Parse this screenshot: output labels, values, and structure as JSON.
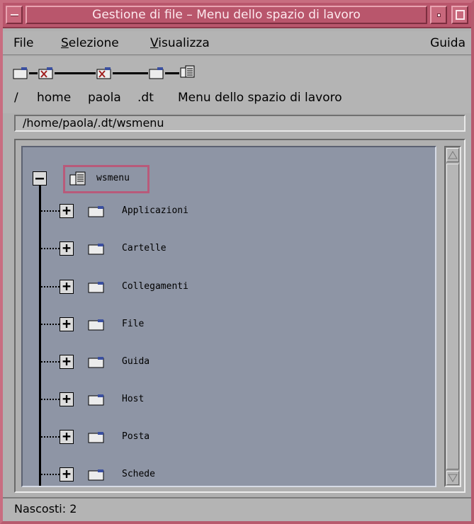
{
  "window": {
    "title": "Gestione di file – Menu dello spazio di lavoro"
  },
  "menubar": {
    "file": "File",
    "selezione": "Selezione",
    "visualizza": "Visualizza",
    "guida": "Guida"
  },
  "iconic_path": {
    "labels": [
      "/",
      "home",
      "paola",
      ".dt",
      "Menu dello spazio di lavoro"
    ]
  },
  "current_path": "/home/paola/.dt/wsmenu",
  "tree": {
    "root": {
      "label": "wsmenu",
      "toggle": "–",
      "icon": "wsmenu-file-icon"
    },
    "children": [
      {
        "label": "Applicazioni",
        "toggle": "+",
        "icon": "folder-icon"
      },
      {
        "label": "Cartelle",
        "toggle": "+",
        "icon": "folder-icon"
      },
      {
        "label": "Collegamenti",
        "toggle": "+",
        "icon": "folder-icon"
      },
      {
        "label": "File",
        "toggle": "+",
        "icon": "folder-icon"
      },
      {
        "label": "Guida",
        "toggle": "+",
        "icon": "folder-icon"
      },
      {
        "label": "Host",
        "toggle": "+",
        "icon": "folder-icon"
      },
      {
        "label": "Posta",
        "toggle": "+",
        "icon": "folder-icon"
      },
      {
        "label": "Schede",
        "toggle": "+",
        "icon": "folder-icon"
      }
    ]
  },
  "status": "Nascosti: 2",
  "colors": {
    "titlebar": "#b9566c",
    "tree_bg": "#8e95a5",
    "selection_border": "#b85a7a"
  }
}
